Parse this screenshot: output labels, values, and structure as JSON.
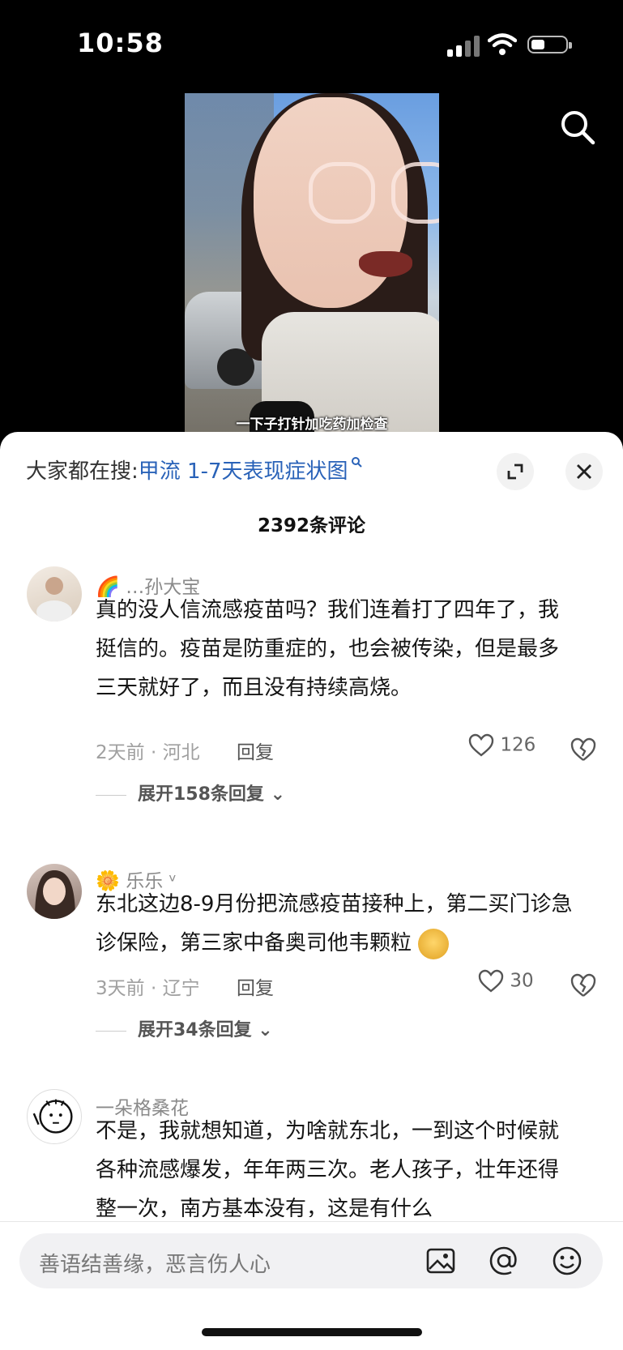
{
  "status": {
    "time": "10:58"
  },
  "video": {
    "subtitle": "一下子打针加吃药加检查"
  },
  "search": {
    "prefix": "大家都在搜:",
    "keyword": "甲流 1-7天表现症状图"
  },
  "comment_count": "2392条评论",
  "comments": [
    {
      "username": "…孙大宝",
      "text": "真的没人信流感疫苗吗？我们连着打了四年了，我挺信的。疫苗是防重症的，也会被传染，但是最多三天就好了，而且没有持续高烧。",
      "meta": "2天前 · 河北",
      "reply": "回复",
      "likes": "126",
      "expand": "展开158条回复"
    },
    {
      "username": "乐乐 ᵛ",
      "text": "东北这边8-9月份把流感疫苗接种上，第二买门诊急诊保险，第三家中备奥司他韦颗粒",
      "meta": "3天前 · 辽宁",
      "reply": "回复",
      "likes": "30",
      "expand": "展开34条回复"
    },
    {
      "username": "一朵格桑花",
      "text": "不是，我就想知道，为啥就东北，一到这个时候就各种流感爆发，年年两三次。老人孩子，壮年还得整一次，南方基本没有，这是有什么"
    }
  ],
  "input": {
    "placeholder": "善语结善缘，恶言伤人心"
  },
  "colors": {
    "keyword": "#2962b8",
    "sheet": "#ffffff",
    "background": "#000000"
  }
}
